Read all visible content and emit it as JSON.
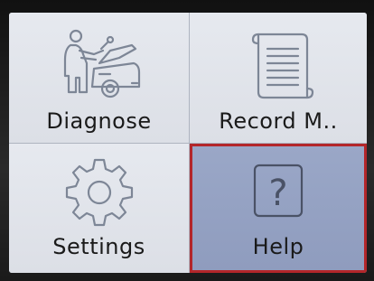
{
  "menu": {
    "items": [
      {
        "label": "Diagnose",
        "icon": "mechanic-car-icon",
        "selected": false
      },
      {
        "label": "Record M..",
        "icon": "document-scroll-icon",
        "selected": false
      },
      {
        "label": "Settings",
        "icon": "gear-icon",
        "selected": false
      },
      {
        "label": "Help",
        "icon": "question-mark-icon",
        "selected": true
      }
    ]
  },
  "colors": {
    "screen_bg": "#dfe3ea",
    "selected_bg": "#94a1c2",
    "selected_border": "#b3262a",
    "icon_stroke": "#7d8696"
  }
}
